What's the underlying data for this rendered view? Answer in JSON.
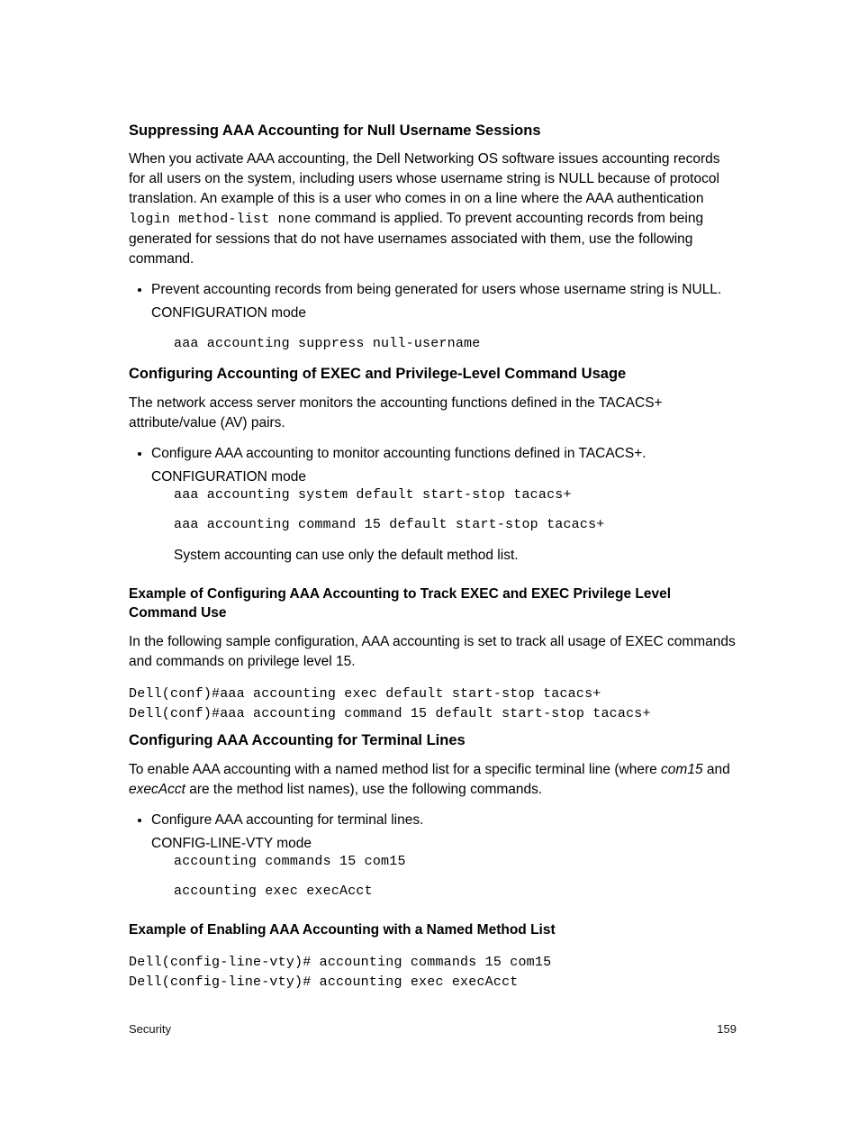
{
  "s1": {
    "heading": "Suppressing AAA Accounting for Null Username Sessions",
    "para_before_code": "When you activate AAA accounting, the Dell Networking OS software issues accounting records for all users on the system, including users whose username string is NULL because of protocol translation. An example of this is a user who comes in on a line where the AAA authentication ",
    "inline_code": "login method-list none",
    "para_after_code": " command is applied. To prevent accounting records from being generated for sessions that do not have usernames associated with them, use the following command.",
    "bullet": "Prevent accounting records from being generated for users whose username string is NULL.",
    "mode": "CONFIGURATION mode",
    "cmd": "aaa accounting suppress null-username"
  },
  "s2": {
    "heading": "Configuring Accounting of EXEC and Privilege-Level Command Usage",
    "para": "The network access server monitors the accounting functions defined in the TACACS+ attribute/value (AV) pairs.",
    "bullet": "Configure AAA accounting to monitor accounting functions defined in TACACS+.",
    "mode": "CONFIGURATION mode",
    "cmd1": "aaa accounting system default start-stop tacacs+",
    "cmd2": "aaa accounting command 15 default start-stop tacacs+",
    "note": "System accounting can use only the default method list.",
    "example_heading": "Example of Configuring AAA Accounting to Track EXEC and EXEC Privilege Level Command Use",
    "example_intro": "In the following sample configuration, AAA accounting is set to track all usage of EXEC commands and commands on privilege level 15.",
    "example_code": "Dell(conf)#aaa accounting exec default start-stop tacacs+\nDell(conf)#aaa accounting command 15 default start-stop tacacs+"
  },
  "s3": {
    "heading": "Configuring AAA Accounting for Terminal Lines",
    "para_p1": "To enable AAA accounting with a named method list for a specific terminal line (where ",
    "para_em1": "com15",
    "para_p2": " and ",
    "para_em2": "execAcct",
    "para_p3": " are the method list names), use the following commands.",
    "bullet": "Configure AAA accounting for terminal lines.",
    "mode": "CONFIG-LINE-VTY mode",
    "cmd1": "accounting commands 15 com15",
    "cmd2": "accounting exec execAcct",
    "example_heading": "Example of Enabling AAA Accounting with a Named Method List",
    "example_code": "Dell(config-line-vty)# accounting commands 15 com15\nDell(config-line-vty)# accounting exec execAcct"
  },
  "footer": {
    "left": "Security",
    "right": "159"
  }
}
